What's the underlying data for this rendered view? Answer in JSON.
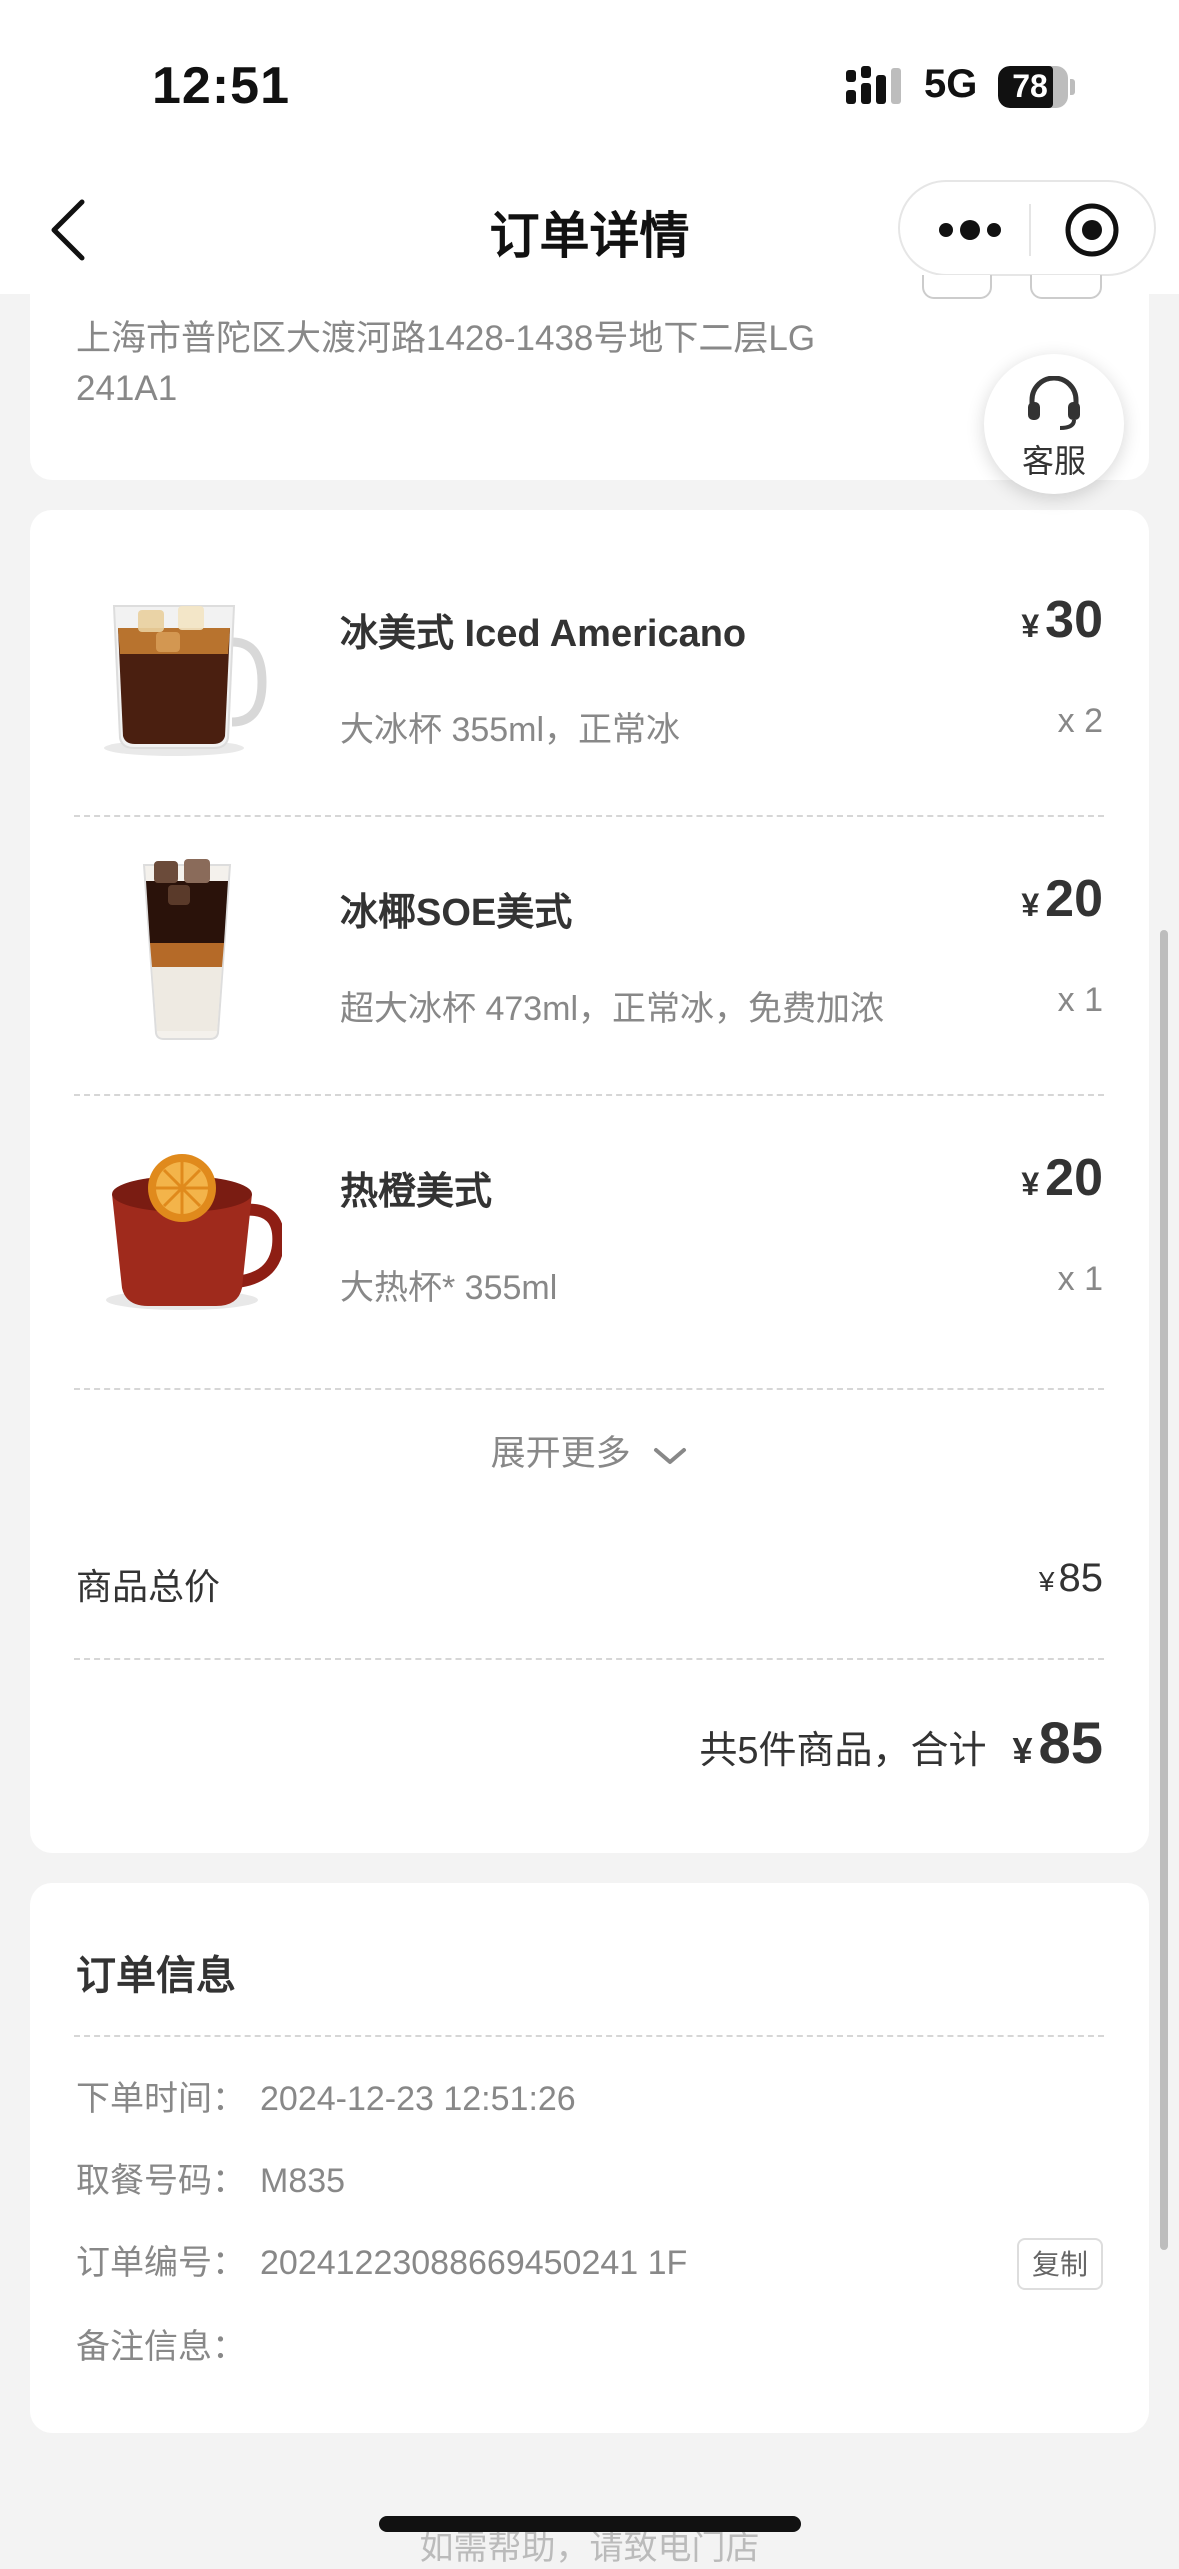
{
  "status_bar": {
    "time": "12:51",
    "network": "5G",
    "battery": "78",
    "battery_level": 0.78
  },
  "nav": {
    "title": "订单详情"
  },
  "address": {
    "text": "上海市普陀区大渡河路1428-1438号地下二层LG 241A1"
  },
  "customer_service": {
    "label": "客服",
    "icon": "headset-icon"
  },
  "items": [
    {
      "name": "冰美式 Iced Americano",
      "spec": "大冰杯 355ml，正常冰",
      "currency": "¥",
      "price": "30",
      "qty": "x 2",
      "image": "iced-americano-glass"
    },
    {
      "name": "冰椰SOE美式",
      "spec": "超大冰杯 473ml，正常冰，免费加浓",
      "currency": "¥",
      "price": "20",
      "qty": "x 1",
      "image": "iced-coconut-americano-cup"
    },
    {
      "name": "热橙美式",
      "spec": "大热杯* 355ml",
      "currency": "¥",
      "price": "20",
      "qty": "x 1",
      "image": "hot-orange-americano-mug"
    }
  ],
  "expand_label": "展开更多",
  "subtotal": {
    "label": "商品总价",
    "currency": "¥",
    "value": "85"
  },
  "total": {
    "label": "共5件商品，合计",
    "currency": "¥",
    "value": "85"
  },
  "order_info": {
    "title": "订单信息",
    "rows": [
      {
        "label": "下单时间：",
        "value": "2024-12-23 12:51:26"
      },
      {
        "label": "取餐号码：",
        "value": "M835"
      },
      {
        "label": "订单编号：",
        "value": "20241223088669450241 1F"
      },
      {
        "label": "备注信息：",
        "value": ""
      }
    ],
    "copy_label": "复制"
  },
  "footer_hint": "如需帮助，请致电门店"
}
